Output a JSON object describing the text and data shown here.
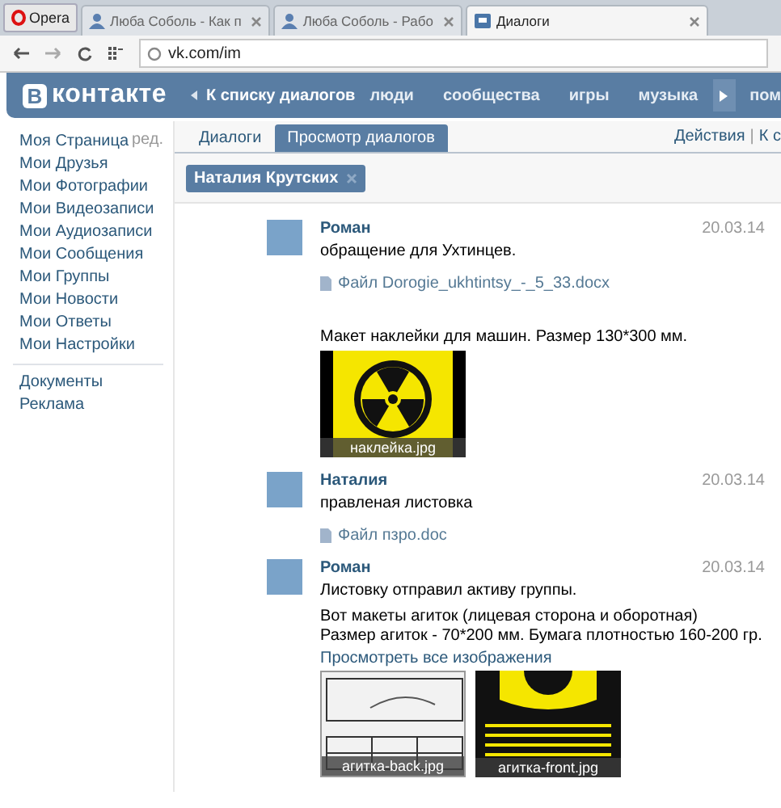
{
  "browser": {
    "menu_button": "Opera",
    "address": "vk.com/im",
    "tabs": [
      {
        "title": "Люба Соболь - Как п",
        "selected": false
      },
      {
        "title": "Люба Соболь - Рабо",
        "selected": false
      },
      {
        "title": "Диалоги",
        "selected": true
      }
    ]
  },
  "header": {
    "logo_badge": "В",
    "logo_text": "контакте",
    "back_link": "К списку диалогов",
    "nav": [
      "люди",
      "сообщества",
      "игры",
      "музыка"
    ],
    "nav_more": "пом"
  },
  "sidebar": {
    "edit_link": "ред.",
    "items": [
      "Моя Страница",
      "Мои Друзья",
      "Мои Фотографии",
      "Мои Видеозаписи",
      "Мои Аудиозаписи",
      "Мои Сообщения",
      "Мои Группы",
      "Мои Новости",
      "Мои Ответы",
      "Мои Настройки"
    ],
    "extra_items": [
      "Документы",
      "Реклама"
    ]
  },
  "main": {
    "tabs": [
      {
        "label": "Диалоги",
        "selected": false
      },
      {
        "label": "Просмотр диалогов",
        "selected": true
      }
    ],
    "actions": [
      "Действия",
      "К с"
    ],
    "actions_separator": "|",
    "chip": "Наталия Крутских",
    "messages": [
      {
        "author": "Роман",
        "date": "20.03.14",
        "parts": [
          {
            "kind": "text",
            "text": "обращение для Ухтинцев."
          },
          {
            "kind": "file",
            "text": "Файл Dorogie_ukhtintsy_-_5_33.docx"
          },
          {
            "kind": "text",
            "text": "Макет наклейки для машин. Размер 130*300 мм."
          },
          {
            "kind": "photos",
            "photos": [
              {
                "kind": "sticker",
                "caption": "наклейка.jpg"
              }
            ]
          }
        ]
      },
      {
        "author": "Наталия",
        "date": "20.03.14",
        "parts": [
          {
            "kind": "text",
            "text": "правленая листовка"
          },
          {
            "kind": "file",
            "text": "Файл пзро.doc"
          }
        ]
      },
      {
        "author": "Роман",
        "date": "20.03.14",
        "parts": [
          {
            "kind": "text",
            "text": "Листовку отправил активу группы."
          },
          {
            "kind": "text",
            "text": "Вот макеты агиток (лицевая сторона и оборотная)\nРазмер агиток - 70*200 мм. Бумага плотностью 160-200 гр."
          },
          {
            "kind": "link",
            "text": "Просмотреть все изображения"
          },
          {
            "kind": "photos",
            "photos": [
              {
                "kind": "leaflet-back",
                "caption": "агитка-back.jpg"
              },
              {
                "kind": "leaflet-front",
                "caption": "агитка-front.jpg"
              }
            ]
          }
        ]
      }
    ]
  }
}
